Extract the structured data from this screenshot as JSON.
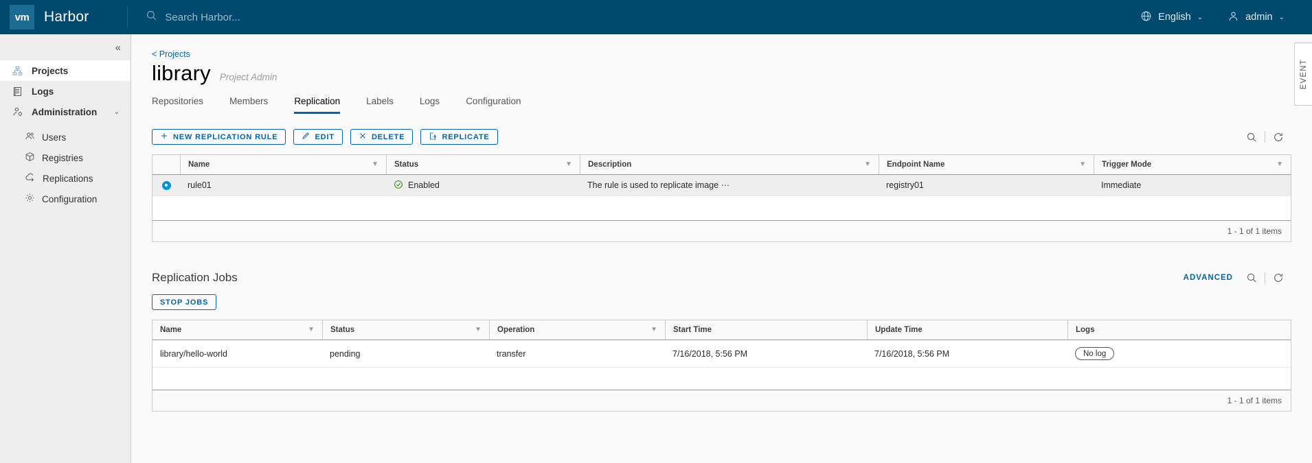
{
  "header": {
    "logo_text": "vm",
    "brand": "Harbor",
    "search_placeholder": "Search Harbor...",
    "language": "English",
    "user": "admin",
    "caret": "⌄"
  },
  "sidebar": {
    "collapse_icon": "«",
    "items": [
      {
        "label": "Projects",
        "icon": "projects-icon",
        "active": true
      },
      {
        "label": "Logs",
        "icon": "logs-icon",
        "active": false
      },
      {
        "label": "Administration",
        "icon": "administration-icon",
        "active": false,
        "chevron": "⌄"
      }
    ],
    "sub_items": [
      {
        "label": "Users",
        "icon": "users-icon"
      },
      {
        "label": "Registries",
        "icon": "registries-icon"
      },
      {
        "label": "Replications",
        "icon": "replications-icon"
      },
      {
        "label": "Configuration",
        "icon": "configuration-icon"
      }
    ]
  },
  "main": {
    "breadcrumb": "< Projects",
    "project_title": "library",
    "project_role": "Project Admin",
    "tabs": [
      {
        "label": "Repositories",
        "active": false
      },
      {
        "label": "Members",
        "active": false
      },
      {
        "label": "Replication",
        "active": true
      },
      {
        "label": "Labels",
        "active": false
      },
      {
        "label": "Logs",
        "active": false
      },
      {
        "label": "Configuration",
        "active": false
      }
    ],
    "toolbar": {
      "new_rule": "NEW REPLICATION RULE",
      "edit": "EDIT",
      "delete": "DELETE",
      "replicate": "REPLICATE"
    },
    "rules_table": {
      "columns": [
        "Name",
        "Status",
        "Description",
        "Endpoint Name",
        "Trigger Mode"
      ],
      "rows": [
        {
          "selected": true,
          "name": "rule01",
          "status": "Enabled",
          "description": "The rule is used to replicate image ···",
          "endpoint": "registry01",
          "trigger": "Immediate"
        }
      ],
      "footer": "1 - 1 of 1 items"
    },
    "jobs": {
      "title": "Replication Jobs",
      "advanced": "ADVANCED",
      "stop_jobs": "STOP JOBS",
      "columns": [
        "Name",
        "Status",
        "Operation",
        "Start Time",
        "Update Time",
        "Logs"
      ],
      "rows": [
        {
          "name": "library/hello-world",
          "status": "pending",
          "operation": "transfer",
          "start_time": "7/16/2018, 5:56 PM",
          "update_time": "7/16/2018, 5:56 PM",
          "logs": "No log"
        }
      ],
      "footer": "1 - 1 of 1 items"
    },
    "event_tab": "EVENT"
  },
  "colors": {
    "header_bg": "#00496e",
    "accent": "#0065ab",
    "radio": "#0095d3",
    "status_ok": "#318700"
  }
}
